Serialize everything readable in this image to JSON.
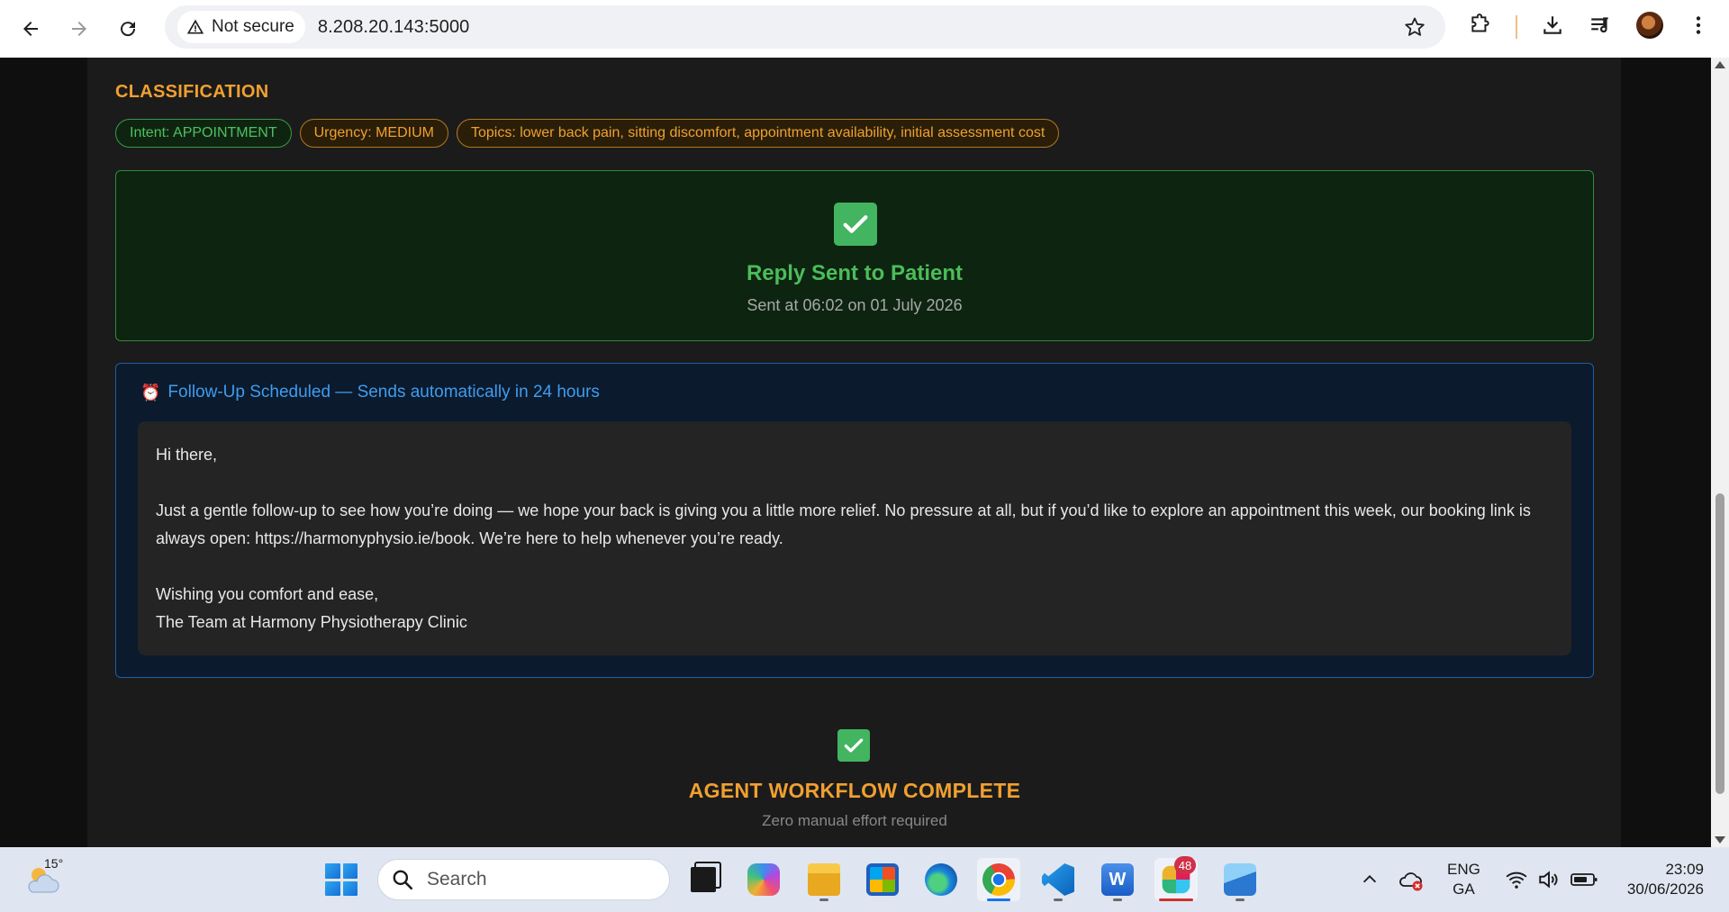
{
  "browser": {
    "security_label": "Not secure",
    "url": "8.208.20.143:5000"
  },
  "page": {
    "classification": {
      "title": "CLASSIFICATION",
      "chips": [
        {
          "label": "Intent: APPOINTMENT",
          "tone": "green"
        },
        {
          "label": "Urgency: MEDIUM",
          "tone": "orange"
        },
        {
          "label": "Topics: lower back pain, sitting discomfort, appointment availability, initial assessment cost",
          "tone": "orange"
        }
      ]
    },
    "reply_sent": {
      "title": "Reply Sent to Patient",
      "timestamp": "Sent at 06:02 on 01 July 2026"
    },
    "followup": {
      "icon": "alarm-clock-icon",
      "heading": "Follow-Up Scheduled — Sends automatically in 24 hours",
      "message": {
        "greeting": "Hi there,",
        "body": "Just a gentle follow-up to see how you’re doing — we hope your back is giving you a little more relief. No pressure at all, but if you’d like to explore an appointment this week, our booking link is always open: https://harmonyphysio.ie/book. We’re here to help whenever you’re ready.",
        "signoff": "Wishing you comfort and ease,",
        "signature": "The Team at Harmony Physiotherapy Clinic"
      }
    },
    "complete": {
      "title": "AGENT WORKFLOW COMPLETE",
      "subtitle": "Zero manual effort required"
    }
  },
  "taskbar": {
    "weather_temp": "15°",
    "search_placeholder": "Search",
    "slack_badge": "48",
    "lang_line1": "ENG",
    "lang_line2": "GA",
    "time": "23:09",
    "date": "30/06/2026"
  },
  "colors": {
    "accent_orange": "#f0a030",
    "success_green": "#4cbc5a",
    "info_blue": "#3f9cf0"
  }
}
